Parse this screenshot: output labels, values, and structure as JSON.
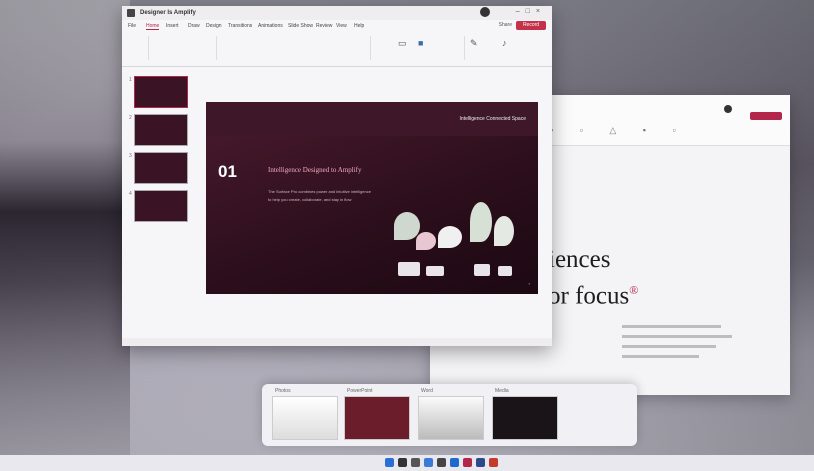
{
  "ppt_window": {
    "filename": "Designer Is Amplify",
    "tabs": [
      "File",
      "Home",
      "Insert",
      "Draw",
      "Design",
      "Transitions",
      "Animations",
      "Slide Show",
      "Review",
      "View",
      "Help"
    ],
    "active_tab": "Home",
    "share_label": "Share",
    "record_label": "Record"
  },
  "slide": {
    "number": "01",
    "heading": "Intelligence Designed to Amplify",
    "nav_left": "Intelligence",
    "nav_right": "Connected Space",
    "body_line1": "The Surface Pro combines power and intuitive intelligence",
    "body_line2": "to help you create, collaborate, and stay in flow"
  },
  "thumbnails": [
    "1",
    "2",
    "3",
    "4"
  ],
  "background_window": {
    "big_text_line1": "iences",
    "big_text_line2": "or focus",
    "reg_mark": "®"
  },
  "task_switcher": {
    "windows": [
      "Photos",
      "PowerPoint",
      "Word",
      "Media"
    ]
  },
  "colors": {
    "accent": "#b3264a",
    "slide_bg": "#2b0e1b"
  }
}
